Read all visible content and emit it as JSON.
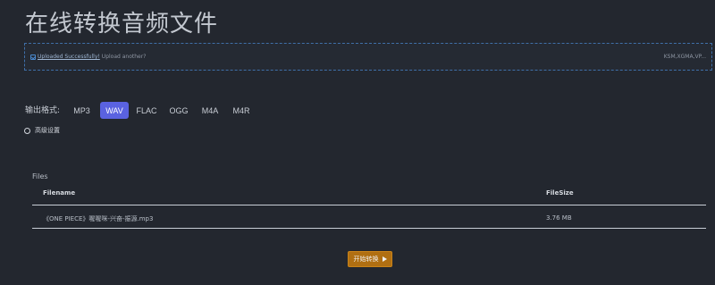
{
  "page": {
    "title": "在线转换音频文件"
  },
  "upload": {
    "status_link": "Uploaded Successfully!",
    "upload_another": "Upload another?",
    "formats_hint": "KSM,XGMA,VP..."
  },
  "format": {
    "label": "输出格式:",
    "options": [
      "MP3",
      "WAV",
      "FLAC",
      "OGG",
      "M4A",
      "M4R"
    ],
    "selected": "WAV"
  },
  "advanced": {
    "label": "高级设置"
  },
  "files": {
    "heading": "Files",
    "columns": {
      "filename": "Filename",
      "filesize": "FileSize"
    },
    "rows": [
      {
        "filename": "《ONE PIECE》喔喔咪-兴奋-振源.mp3",
        "filesize": "3.76 MB"
      }
    ]
  },
  "actions": {
    "start_label": "开始转换"
  },
  "colors": {
    "background": "#23272f",
    "accent": "#5a62e0",
    "start_button": "#b06f12",
    "upload_border": "#3f6fa8"
  }
}
